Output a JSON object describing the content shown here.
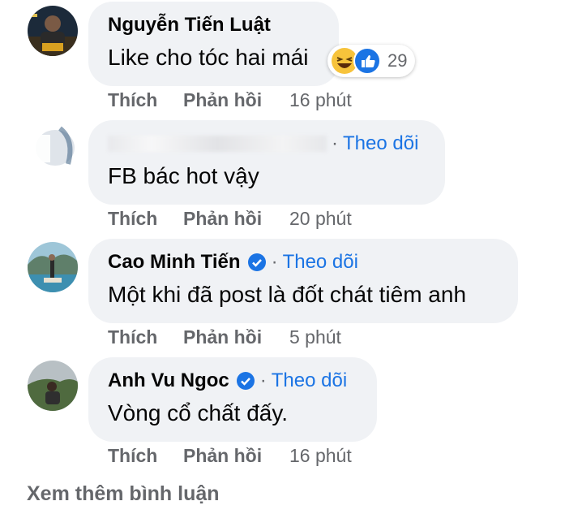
{
  "comments": [
    {
      "name": "Nguyễn Tiến Luật",
      "text": "Like cho tóc hai mái",
      "like_label": "Thích",
      "reply_label": "Phản hồi",
      "time": "16 phút",
      "reaction_count": "29",
      "reaction_icons": [
        "haha-icon",
        "like-icon"
      ]
    },
    {
      "name": "",
      "dot": "·",
      "follow": "Theo dõi",
      "text": "FB bác hot vậy",
      "like_label": "Thích",
      "reply_label": "Phản hồi",
      "time": "20 phút"
    },
    {
      "name": "Cao Minh Tiến",
      "dot": "·",
      "follow": "Theo dõi",
      "text": "Một khi đã post là đốt chát tiêm anh",
      "like_label": "Thích",
      "reply_label": "Phản hồi",
      "time": "5 phút",
      "verified": true
    },
    {
      "name": "Anh Vu Ngoc",
      "dot": "·",
      "follow": "Theo dõi",
      "text": "Vòng cổ chất đấy.",
      "like_label": "Thích",
      "reply_label": "Phản hồi",
      "time": "16 phút",
      "verified": true
    }
  ],
  "more_comments_label": "Xem thêm bình luận",
  "colors": {
    "bubble": "#f0f2f5",
    "follow": "#1b74e4",
    "secondary_text": "#65676b",
    "verified": "#1b74e4"
  }
}
